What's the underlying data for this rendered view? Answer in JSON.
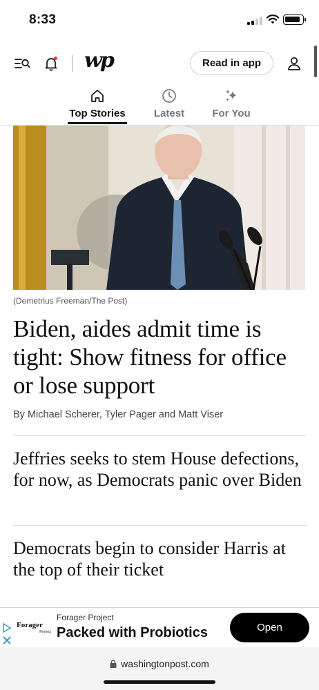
{
  "status_bar": {
    "time": "8:33"
  },
  "header": {
    "logo": "wp",
    "read_in_app": "Read in app"
  },
  "tabs": [
    {
      "label": "Top Stories",
      "icon": "home-icon",
      "active": true
    },
    {
      "label": "Latest",
      "icon": "clock-icon",
      "active": false
    },
    {
      "label": "For You",
      "icon": "sparkle-icon",
      "active": false
    }
  ],
  "lead_story": {
    "photo_credit": "(Demetrius Freeman/The Post)",
    "headline": "Biden, aides admit time is tight: Show fitness for office or lose support",
    "byline": "By Michael Scherer, Tyler Pager and Matt Viser"
  },
  "stories": [
    {
      "headline": "Jeffries seeks to stem House defections, for now, as Democrats panic over Biden"
    },
    {
      "headline": "Democrats begin to consider Harris at the top of their ticket"
    }
  ],
  "ad": {
    "logo_text": "Forager",
    "logo_subtext": "Project",
    "brand": "Forager Project",
    "text": "Packed with Probiotics",
    "cta": "Open"
  },
  "url_bar": {
    "url": "washingtonpost.com"
  },
  "colors": {
    "accent": "#111111",
    "muted_tab": "#777777",
    "ad_choices": "#3aa0d8"
  }
}
